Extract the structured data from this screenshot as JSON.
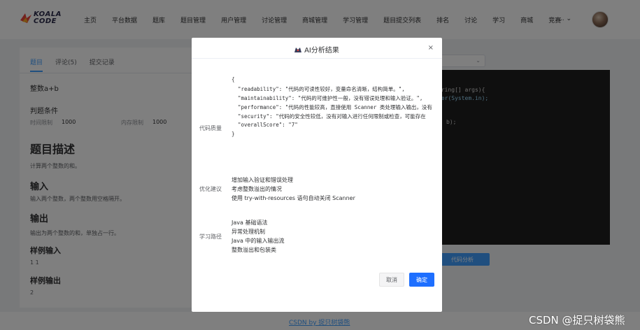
{
  "header": {
    "logo_line1": "KOALA",
    "logo_line2": "CODE",
    "nav": [
      "主页",
      "平台数据",
      "题库",
      "题目管理",
      "用户管理",
      "讨论管理",
      "商城管理",
      "学习管理",
      "题目提交列表",
      "排名",
      "讨论",
      "学习",
      "商城",
      "竞赛"
    ],
    "more": "... ⌄"
  },
  "left": {
    "tabs": [
      "题目",
      "评论(5)",
      "提交记录"
    ],
    "problem_title": "整数a+b",
    "conditions_title": "判题条件",
    "time_limit_label": "时间限制",
    "time_limit_value": "1000",
    "memory_limit_label": "内存限制",
    "memory_limit_value": "1000",
    "desc_heading": "题目描述",
    "desc_text": "计算两个整数的和。",
    "input_heading": "输入",
    "input_text": "输入两个整数，两个整数用空格隔开。",
    "output_heading": "输出",
    "output_text": "输出为两个整数的和，单独占一行。",
    "sample_input_heading": "样例输入",
    "sample_input": "1 1",
    "sample_output_heading": "样例输出",
    "sample_output": "2"
  },
  "right": {
    "code_lines": [
      "tring[] args){",
      "ner(System.in);",
      "b);"
    ],
    "analyze_button": "代码分析"
  },
  "footer": {
    "link": "CSDN by 捉只树袋熊",
    "watermark": "CSDN @捉只树袋熊"
  },
  "dialog": {
    "title": "AI分析结果",
    "close": "×",
    "quality_label": "代码质量",
    "json_lines": [
      "{",
      "  \"readability\": \"代码的可读性较好，变量命名清晰，结构简单。\",",
      "  \"maintainability\": \"代码的可维护性一般，没有错误处理和输入验证。\",",
      "  \"performance\": \"代码的性能较高，直接使用 Scanner 类处理输入输出，没有",
      "  \"security\": \"代码的安全性较低，没有对输入进行任何限制或检查，可能存在",
      "  \"overallScore\": \"7\"",
      "}"
    ],
    "suggest_label": "优化建议",
    "suggestions": [
      "增加输入验证和错误处理",
      "考虑整数溢出的情况",
      "使用 try-with-resources 语句自动关闭 Scanner"
    ],
    "path_label": "学习路径",
    "paths": [
      "Java 基础语法",
      "异常处理机制",
      "Java 中的输入输出流",
      "整数溢出和包装类"
    ],
    "cancel": "取消",
    "confirm": "确定"
  },
  "colors": {
    "accent": "#409eff",
    "confirm": "#1e6fff",
    "editor_bg": "#1e1e1e",
    "overlay": "rgba(0,0,0,0.5)"
  }
}
